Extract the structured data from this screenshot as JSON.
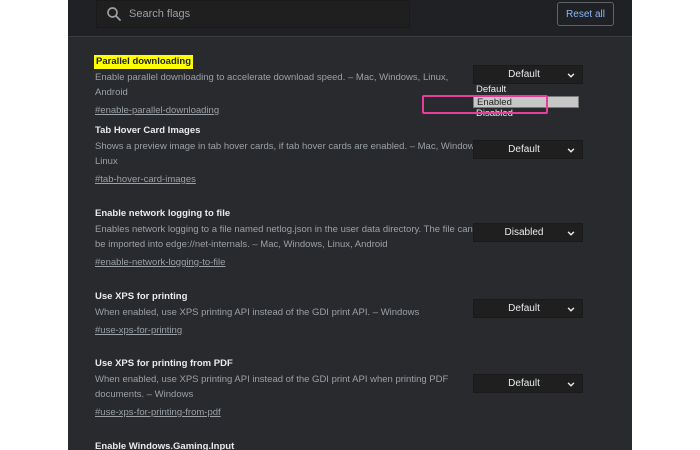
{
  "header": {
    "search_placeholder": "Search flags",
    "reset_label": "Reset all"
  },
  "flags": [
    {
      "title": "Parallel downloading",
      "description": "Enable parallel downloading to accelerate download speed. – Mac, Windows, Linux, Android",
      "link": "#enable-parallel-downloading",
      "value": "Default",
      "highlighted": true
    },
    {
      "title": "Tab Hover Card Images",
      "description": "Shows a preview image in tab hover cards, if tab hover cards are enabled. – Mac, Windows, Linux",
      "link": "#tab-hover-card-images",
      "value": "Default"
    },
    {
      "title": "Enable network logging to file",
      "description": "Enables network logging to a file named netlog.json in the user data directory. The file can be imported into edge://net-internals. – Mac, Windows, Linux, Android",
      "link": "#enable-network-logging-to-file",
      "value": "Disabled"
    },
    {
      "title": "Use XPS for printing",
      "description": "When enabled, use XPS printing API instead of the GDI print API. – Windows",
      "link": "#use-xps-for-printing",
      "value": "Default"
    },
    {
      "title": "Use XPS for printing from PDF",
      "description": "When enabled, use XPS printing API instead of the GDI print API when printing PDF documents. – Windows",
      "link": "#use-xps-for-printing-from-pdf",
      "value": "Default"
    },
    {
      "title": "Enable Windows.Gaming.Input"
    }
  ],
  "dropdown": {
    "options": [
      "Default",
      "Enabled",
      "Disabled"
    ],
    "selected": "Enabled"
  },
  "icons": {
    "search": "search-icon",
    "select_arrow": "chevron-down-icon"
  },
  "colors": {
    "background": "#292a2d",
    "highlight": "#ffff00",
    "callout": "#e83e9b",
    "link_accent": "#8ab4f8"
  }
}
